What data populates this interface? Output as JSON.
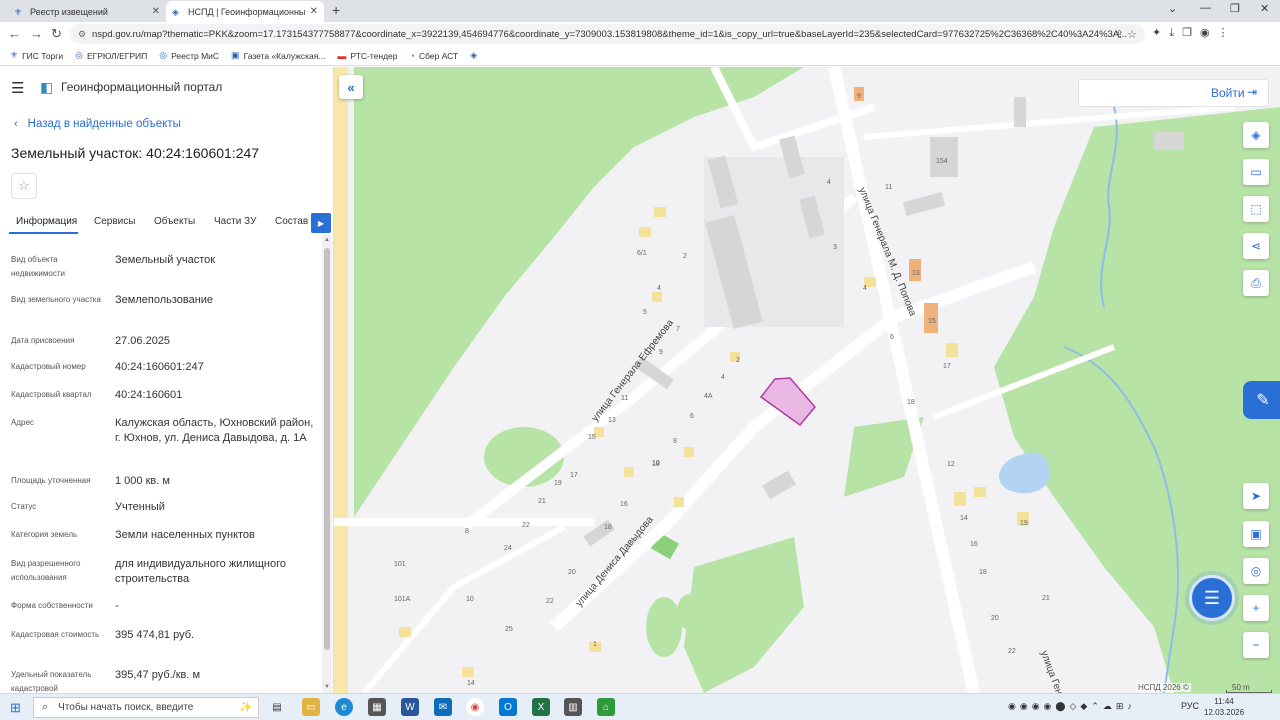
{
  "browser": {
    "tabs": [
      {
        "label": "Реестр извещений",
        "active": false
      },
      {
        "label": "НСПД | Геоинформационный п",
        "active": true
      }
    ],
    "url": "nspd.gov.ru/map?thematic=PKK&zoom=17.173154377758877&coordinate_x=3922139,454694776&coordinate_y=7309003.153819808&theme_id=1&is_copy_url=true&baseLayerId=235&selectedCard=977632725%2C36368%2C40%3A24%3A...",
    "bookmarks": [
      "ГИС Торги",
      "ЕГРЮЛ/ЕГРИП",
      "Реестр МиС",
      "Газета «Калужская...",
      "РТС-тендер",
      "Сбер АСТ"
    ]
  },
  "portal": {
    "title": "Геоинформационный портал",
    "back_label": "Назад в найденные объекты",
    "object_title": "Земельный участок: 40:24:160601:247",
    "tabs": [
      "Информация",
      "Сервисы",
      "Объекты",
      "Части ЗУ",
      "Состав"
    ],
    "active_tab": "Информация",
    "properties": [
      {
        "key": "Вид объекта недвижимости",
        "value": "Земельный участок"
      },
      {
        "key": "Вид земельного участка",
        "value": "Землепользование"
      },
      {
        "key": "Дата присвоения",
        "value": "27.06.2025"
      },
      {
        "key": "Кадастровый номер",
        "value": "40:24:160601:247"
      },
      {
        "key": "Кадастровый квартал",
        "value": "40:24:160601"
      },
      {
        "key": "Адрес",
        "value": "Калужская область, Юхновский район, г. Юхнов, ул. Дениса Давыдова, д. 1А"
      },
      {
        "key": "Площадь уточненная",
        "value": "1 000 кв. м"
      },
      {
        "key": "Статус",
        "value": "Учтенный"
      },
      {
        "key": "Категория земель",
        "value": "Земли населенных пунктов"
      },
      {
        "key": "Вид разрешенного использования",
        "value": "для индивидуального жилищного строительства"
      },
      {
        "key": "Форма собственности",
        "value": "-"
      },
      {
        "key": "Кадастровая стоимость",
        "value": "395 474,81 руб."
      },
      {
        "key": "Удельный показатель кадастровой",
        "value": "395,47 руб./кв. м"
      }
    ]
  },
  "map": {
    "login_label": "Войти",
    "attribution": "НСПД 2026 ©",
    "scale_label": "50 m",
    "streets": [
      "улица Генерала Ефремова",
      "улица Генерала М. Д. Попова",
      "улица Дениса Давыдова",
      "улица Генерала М."
    ],
    "house_numbers": [
      "9",
      "154",
      "11",
      "4",
      "13",
      "15",
      "17",
      "18",
      "6",
      "12",
      "14",
      "16",
      "18",
      "19",
      "20",
      "21",
      "22",
      "4",
      "3",
      "6/1",
      "2",
      "4",
      "5",
      "7",
      "9",
      "11",
      "13",
      "15",
      "2",
      "4",
      "4А",
      "6",
      "8",
      "10",
      "18",
      "16",
      "17",
      "19",
      "21",
      "22",
      "24",
      "20",
      "22",
      "18",
      "8",
      "10",
      "101",
      "101А",
      "25",
      "1",
      "14",
      "3"
    ],
    "colors": {
      "parcel_fill": "#e6a8e0",
      "parcel_stroke": "#b03aa6",
      "green": "#b8e3a6",
      "building": "#d6d6d6",
      "road": "#ffffff",
      "yellow_house": "#f3e39a",
      "orange_house": "#f0b27a",
      "water": "#b3d3f2"
    }
  },
  "taskbar": {
    "search_placeholder": "Чтобы начать поиск, введите",
    "lang": "РУС",
    "time": "11:44",
    "date": "12.03.2026"
  }
}
